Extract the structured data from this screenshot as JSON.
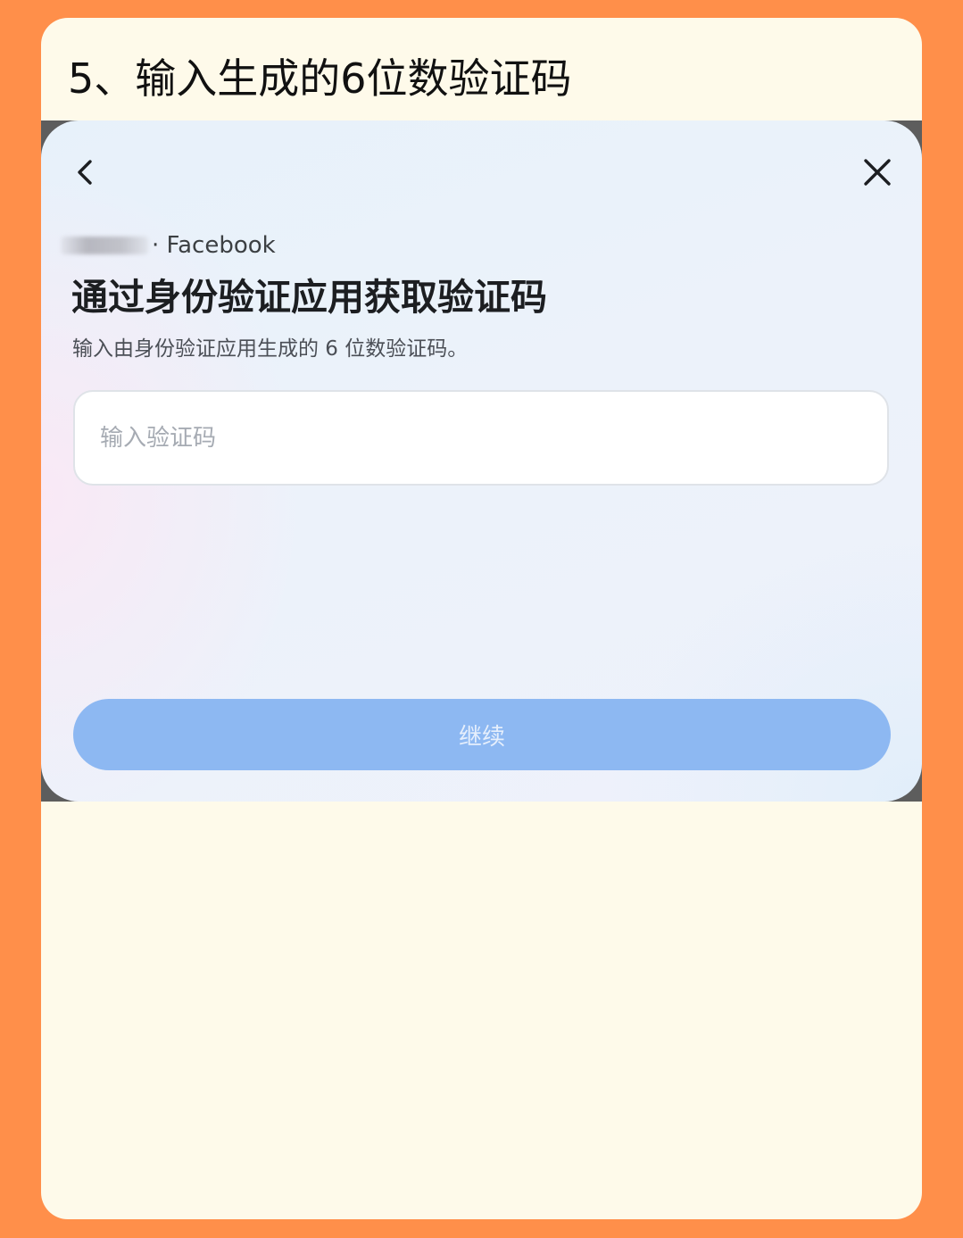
{
  "step": {
    "title": "5、输入生成的6位数验证码"
  },
  "dialog": {
    "account_service": "· Facebook",
    "title": "通过身份验证应用获取验证码",
    "subtitle": "输入由身份验证应用生成的 6 位数验证码。",
    "code_input": {
      "placeholder": "输入验证码",
      "value": ""
    },
    "continue_label": "继续",
    "icons": {
      "back": "chevron-left-icon",
      "close": "close-icon"
    }
  },
  "colors": {
    "page_background": "#FF8F4A",
    "card_background": "#FEFAEA",
    "button_background": "#8DB8F2",
    "button_text": "#E6EFFC"
  }
}
